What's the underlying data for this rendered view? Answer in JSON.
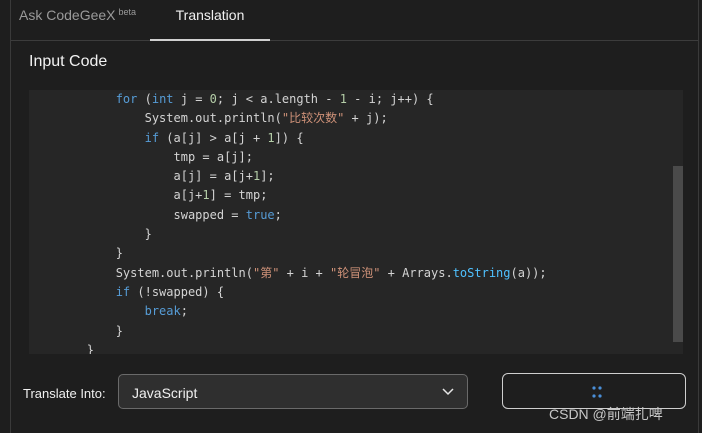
{
  "tabs": {
    "ask_label": "Ask CodeGeeX",
    "ask_badge": "beta",
    "translation_label": "Translation"
  },
  "input_section": {
    "title": "Input Code"
  },
  "code_lines": [
    "            for (int j = 0; j < a.length - 1 - i; j++) {",
    "                System.out.println(\"比较次数\" + j);",
    "                if (a[j] > a[j + 1]) {",
    "                    tmp = a[j];",
    "                    a[j] = a[j+1];",
    "                    a[j+1] = tmp;",
    "                    swapped = true;",
    "                }",
    "            }",
    "            System.out.println(\"第\" + i + \"轮冒泡\" + Arrays.toString(a));",
    "            if (!swapped) {",
    "                break;",
    "            }",
    "        }"
  ],
  "translate": {
    "label": "Translate Into:",
    "selected_language": "JavaScript",
    "chevron_icon": "chevron-down-icon",
    "run_button_icon": "loading-spinner-icon"
  },
  "watermark": "CSDN @前端扎啤",
  "colors": {
    "background": "#1e1e1e",
    "code_background": "#262626",
    "keyword": "#569cd6",
    "number": "#b5cea8",
    "string": "#ce9178",
    "function": "#4fc1ff"
  }
}
